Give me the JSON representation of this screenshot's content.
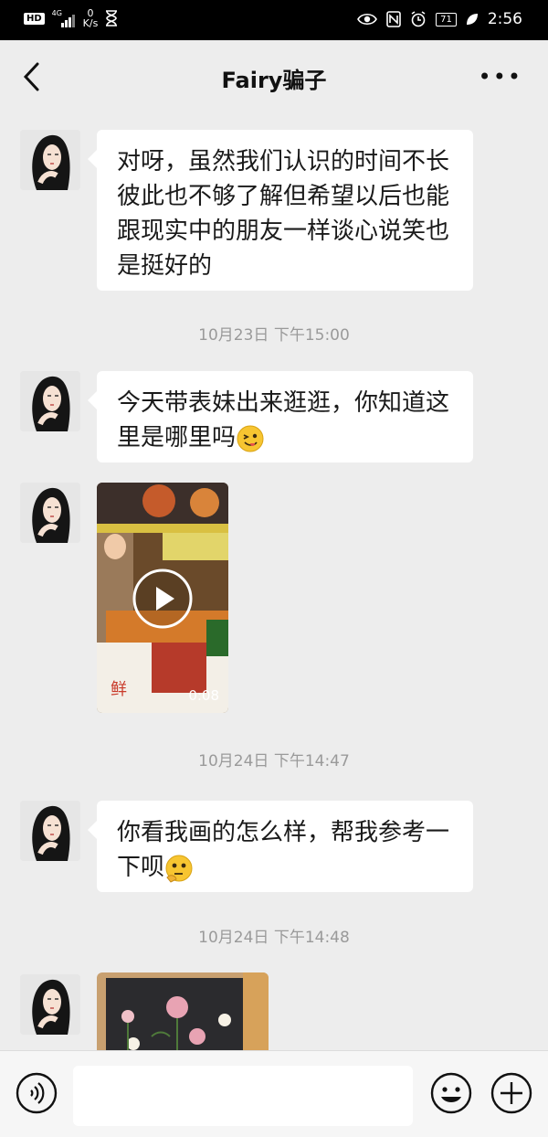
{
  "status_bar": {
    "hd": "HD",
    "network": "4G",
    "speed_value": "0",
    "speed_unit": "K/s",
    "battery": "71",
    "time": "2:56"
  },
  "header": {
    "title": "Fairy骗子"
  },
  "messages": {
    "m1_text": "对呀，虽然我们认识的时间不长彼此也不够了解但希望以后也能跟现实中的朋友一样谈心说笑也是挺好的",
    "t1": "10月23日 下午15:00",
    "m2_text": "今天带表妹出来逛逛，你知道这里是哪里吗",
    "video_duration": "0:08",
    "t2": "10月24日 下午14:47",
    "m4_text": "你看我画的怎么样，帮我参考一下呗",
    "t3": "10月24日 下午14:48"
  },
  "colors": {
    "background": "#ededed",
    "bubble": "#ffffff",
    "status_bar": "#000000",
    "timestamp": "#9a9a9a"
  }
}
